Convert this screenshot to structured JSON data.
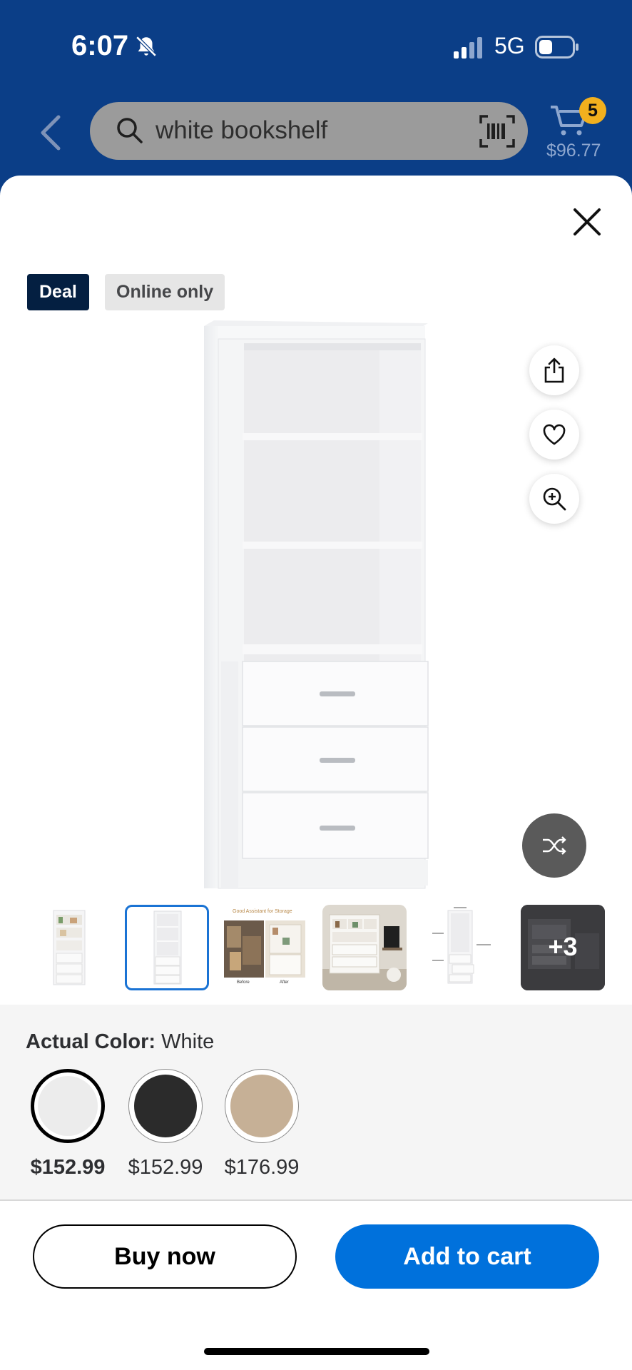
{
  "status_bar": {
    "time": "6:07",
    "network": "5G"
  },
  "header": {
    "search_query": "white bookshelf",
    "cart_count": "5",
    "cart_total": "$96.77"
  },
  "badges": {
    "deal": "Deal",
    "online": "Online only"
  },
  "gallery": {
    "more_count": "+3",
    "thumb3_caption_top": "Good Assistant for Storage",
    "thumb3_before": "Before",
    "thumb3_after": "After"
  },
  "color": {
    "label": "Actual Color:",
    "selected": "White",
    "options": [
      {
        "name": "White",
        "price": "$152.99",
        "hex": "#ececec"
      },
      {
        "name": "Black",
        "price": "$152.99",
        "hex": "#2b2b2b"
      },
      {
        "name": "Tan",
        "price": "$176.99",
        "hex": "#c6b096"
      }
    ]
  },
  "actions": {
    "buy_now": "Buy now",
    "add_to_cart": "Add to cart"
  },
  "colors": {
    "header_bg": "#0b3e87",
    "primary": "#0071dc",
    "deal_bg": "#041f41",
    "cart_badge": "#f2b01e"
  }
}
